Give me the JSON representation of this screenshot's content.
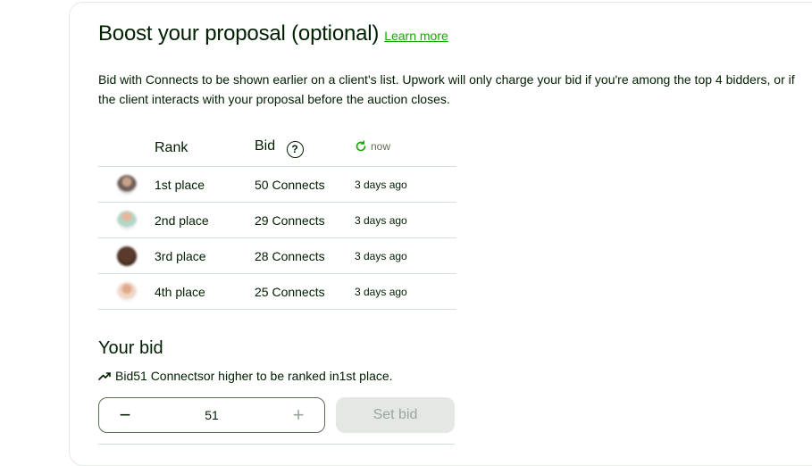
{
  "boost": {
    "title": "Boost your proposal (optional)",
    "learn_more": "Learn more",
    "description": "Bid with Connects to be shown earlier on a client's list. Upwork will only charge your bid if you're among the top 4 bidders, or if the client interacts with your proposal before the auction closes."
  },
  "table": {
    "headers": {
      "rank": "Rank",
      "bid": "Bid",
      "help": "?",
      "refresh": "now"
    },
    "rows": [
      {
        "rank": "1st place",
        "bid": "50 Connects",
        "time": "3 days ago"
      },
      {
        "rank": "2nd place",
        "bid": "29 Connects",
        "time": "3 days ago"
      },
      {
        "rank": "3rd place",
        "bid": "28 Connects",
        "time": "3 days ago"
      },
      {
        "rank": "4th place",
        "bid": "25 Connects",
        "time": "3 days ago"
      }
    ]
  },
  "your_bid": {
    "title": "Your bid",
    "hint_prefix": "Bid ",
    "hint_amount": "51 Connects",
    "hint_middle": " or higher to be ranked in ",
    "hint_place": "1st place",
    "hint_suffix": ".",
    "minus": "−",
    "value": "51",
    "plus": "+",
    "set_bid": "Set bid"
  },
  "colors": {
    "accent": "#14a800",
    "text": "#001e00",
    "muted": "#5e6d55",
    "disabled_bg": "#e4e7e4"
  },
  "icons": [
    "refresh-icon",
    "trend-up-icon",
    "help-icon"
  ]
}
